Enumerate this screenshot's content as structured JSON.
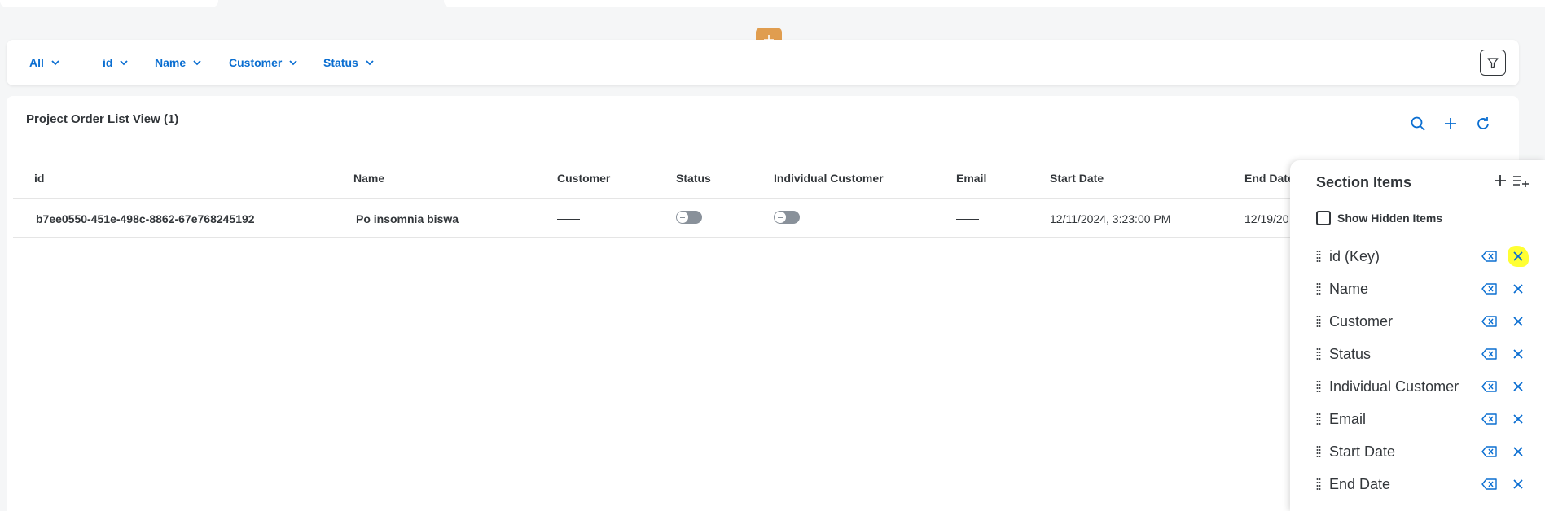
{
  "filter_bar": {
    "chips": [
      {
        "label": "All"
      },
      {
        "label": "id"
      },
      {
        "label": "Name"
      },
      {
        "label": "Customer"
      },
      {
        "label": "Status"
      }
    ]
  },
  "list": {
    "title": "Project Order List View (1)",
    "columns": [
      "id",
      "Name",
      "Customer",
      "Status",
      "Individual Customer",
      "Email",
      "Start Date",
      "End Date"
    ],
    "rows": [
      {
        "id": "b7ee0550-451e-498c-8862-67e768245192",
        "name": "Po insomnia biswa",
        "customer": "",
        "status": false,
        "individual_customer": false,
        "email": "",
        "start_date": "12/11/2024, 3:23:00 PM",
        "end_date": "12/19/20"
      }
    ]
  },
  "panel": {
    "title": "Section Items",
    "show_hidden_label": "Show Hidden Items",
    "show_hidden_checked": false,
    "items": [
      {
        "label": "id (Key)"
      },
      {
        "label": "Name"
      },
      {
        "label": "Customer"
      },
      {
        "label": "Status"
      },
      {
        "label": "Individual Customer"
      },
      {
        "label": "Email"
      },
      {
        "label": "Start Date"
      },
      {
        "label": "End Date"
      }
    ]
  },
  "colors": {
    "accent": "#0a6ed1",
    "add_button": "#e09d4f",
    "highlight": "#ffff33"
  }
}
